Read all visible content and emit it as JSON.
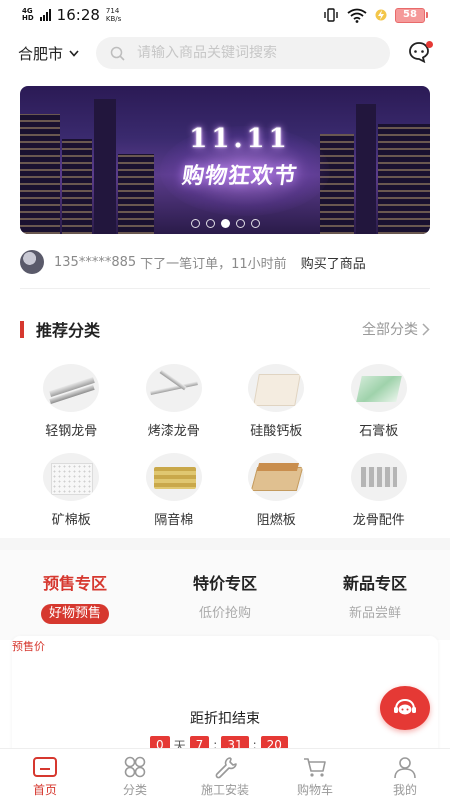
{
  "status_bar": {
    "network": "4G",
    "network_sub": "HD",
    "time": "16:28",
    "speed_value": "714",
    "speed_unit": "KB/s",
    "battery": "58"
  },
  "header": {
    "city": "合肥市",
    "search_placeholder": "请输入商品关键词搜索",
    "icons": [
      "chevron-down-icon",
      "search-icon",
      "message-icon"
    ]
  },
  "banner": {
    "title_line1": "11.11",
    "title_line2": "购物狂欢节",
    "slides": 5,
    "active_slide": 3
  },
  "ticker": {
    "user": "135*****885",
    "action": "下了一笔订单，11小时前",
    "result": "购买了商品"
  },
  "categories_section": {
    "title": "推荐分类",
    "more": "全部分类",
    "items": [
      {
        "label": "轻钢龙骨",
        "icon": "light-steel-keel"
      },
      {
        "label": "烤漆龙骨",
        "icon": "painted-keel"
      },
      {
        "label": "硅酸钙板",
        "icon": "calcium-silicate-board"
      },
      {
        "label": "石膏板",
        "icon": "gypsum-board"
      },
      {
        "label": "矿棉板",
        "icon": "mineral-wool-board"
      },
      {
        "label": "隔音棉",
        "icon": "soundproof-cotton"
      },
      {
        "label": "阻燃板",
        "icon": "fire-retardant-board"
      },
      {
        "label": "龙骨配件",
        "icon": "keel-accessories"
      }
    ]
  },
  "zones": [
    {
      "title": "预售专区",
      "sub": "好物预售",
      "active": true
    },
    {
      "title": "特价专区",
      "sub": "低价抢购",
      "active": false
    },
    {
      "title": "新品专区",
      "sub": "新品尝鲜",
      "active": false
    }
  ],
  "presale": {
    "tag": "预售价",
    "countdown_title": "距折扣结束",
    "days": "0",
    "day_unit": "天",
    "hours": "7",
    "minutes": "31",
    "seconds": "20"
  },
  "tabbar": [
    {
      "label": "首页",
      "icon": "home-icon",
      "active": true
    },
    {
      "label": "分类",
      "icon": "category-icon",
      "active": false
    },
    {
      "label": "施工安装",
      "icon": "wrench-icon",
      "active": false
    },
    {
      "label": "购物车",
      "icon": "cart-icon",
      "active": false
    },
    {
      "label": "我的",
      "icon": "user-icon",
      "active": false
    }
  ],
  "colors": {
    "accent": "#d6382f",
    "countdown_box": "#e53935",
    "search_bg": "#f2f2f2"
  }
}
